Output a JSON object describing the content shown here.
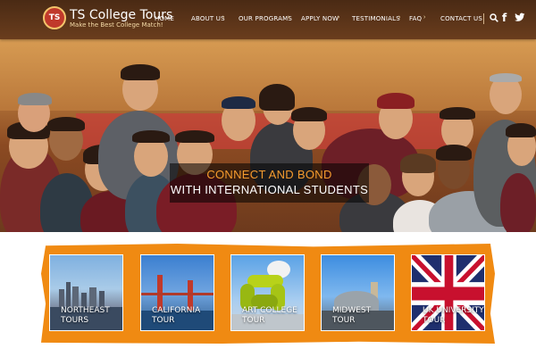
{
  "brand": {
    "title": "TS College Tours",
    "tagline": "Make the Best College Match!",
    "logo_text": "TS"
  },
  "nav": {
    "items": [
      {
        "label": "HOME",
        "has_submenu": false
      },
      {
        "label": "ABOUT US",
        "has_submenu": true
      },
      {
        "label": "OUR PROGRAMS",
        "has_submenu": true
      },
      {
        "label": "APPLY NOW",
        "has_submenu": true
      },
      {
        "label": "TESTIMONIALS",
        "has_submenu": true
      },
      {
        "label": "FAQ",
        "has_submenu": true
      },
      {
        "label": "CONTACT US",
        "has_submenu": false
      }
    ],
    "icons": [
      "search-icon",
      "facebook-icon",
      "twitter-icon"
    ]
  },
  "hero": {
    "line1": "CONNECT AND BOND",
    "line2": "WITH INTERNATIONAL STUDENTS"
  },
  "tours": [
    {
      "label": "NORTHEAST\nTOURS"
    },
    {
      "label": "CALIFORNIA\nTOUR"
    },
    {
      "label": "ART COLLEGE\nTOUR"
    },
    {
      "label": "MIDWEST\nTOUR"
    },
    {
      "label": "UK UNIVERSITY\nTOUR"
    }
  ],
  "colors": {
    "header_bg": "#5a3319",
    "accent_orange": "#f08a12",
    "caption_orange": "#f59b2e"
  }
}
